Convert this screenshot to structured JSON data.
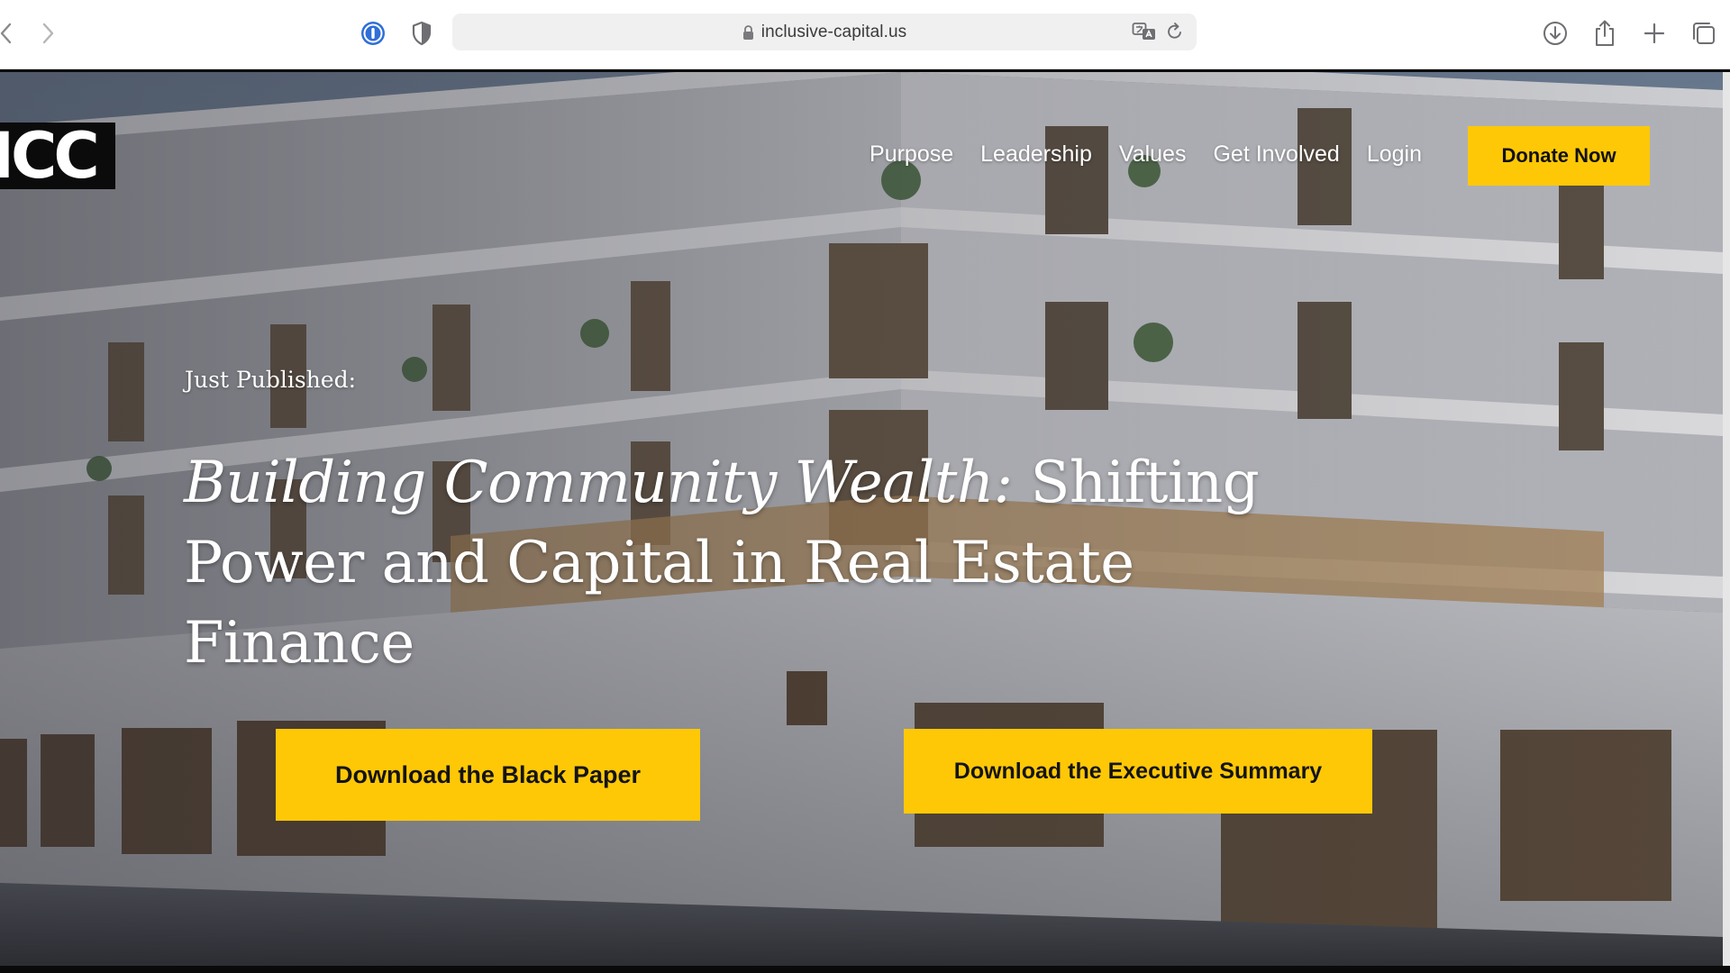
{
  "browser": {
    "url": "inclusive-capital.us",
    "icons": {
      "back": "chevron-left-icon",
      "forward": "chevron-right-icon",
      "password_manager": "password-manager-icon",
      "privacy": "shield-icon",
      "lock": "lock-icon",
      "translate": "translate-icon",
      "reload": "reload-icon",
      "downloads": "download-icon",
      "share": "share-icon",
      "new_tab": "plus-icon",
      "tabs_overview": "tabs-icon"
    }
  },
  "site": {
    "logo_text": "ICC",
    "nav": [
      {
        "label": "Purpose"
      },
      {
        "label": "Leadership"
      },
      {
        "label": "Values"
      },
      {
        "label": "Get Involved"
      },
      {
        "label": "Login"
      }
    ],
    "donate_label": "Donate Now",
    "accent_color": "#ffc807"
  },
  "hero": {
    "eyebrow": "Just Published:",
    "headline_italic": "Building Community Wealth:",
    "headline_rest": " Shifting Power and Capital in Real Estate Finance",
    "cta_black_paper": "Download the Black Paper",
    "cta_executive_summary": "Download the Executive Summary"
  }
}
